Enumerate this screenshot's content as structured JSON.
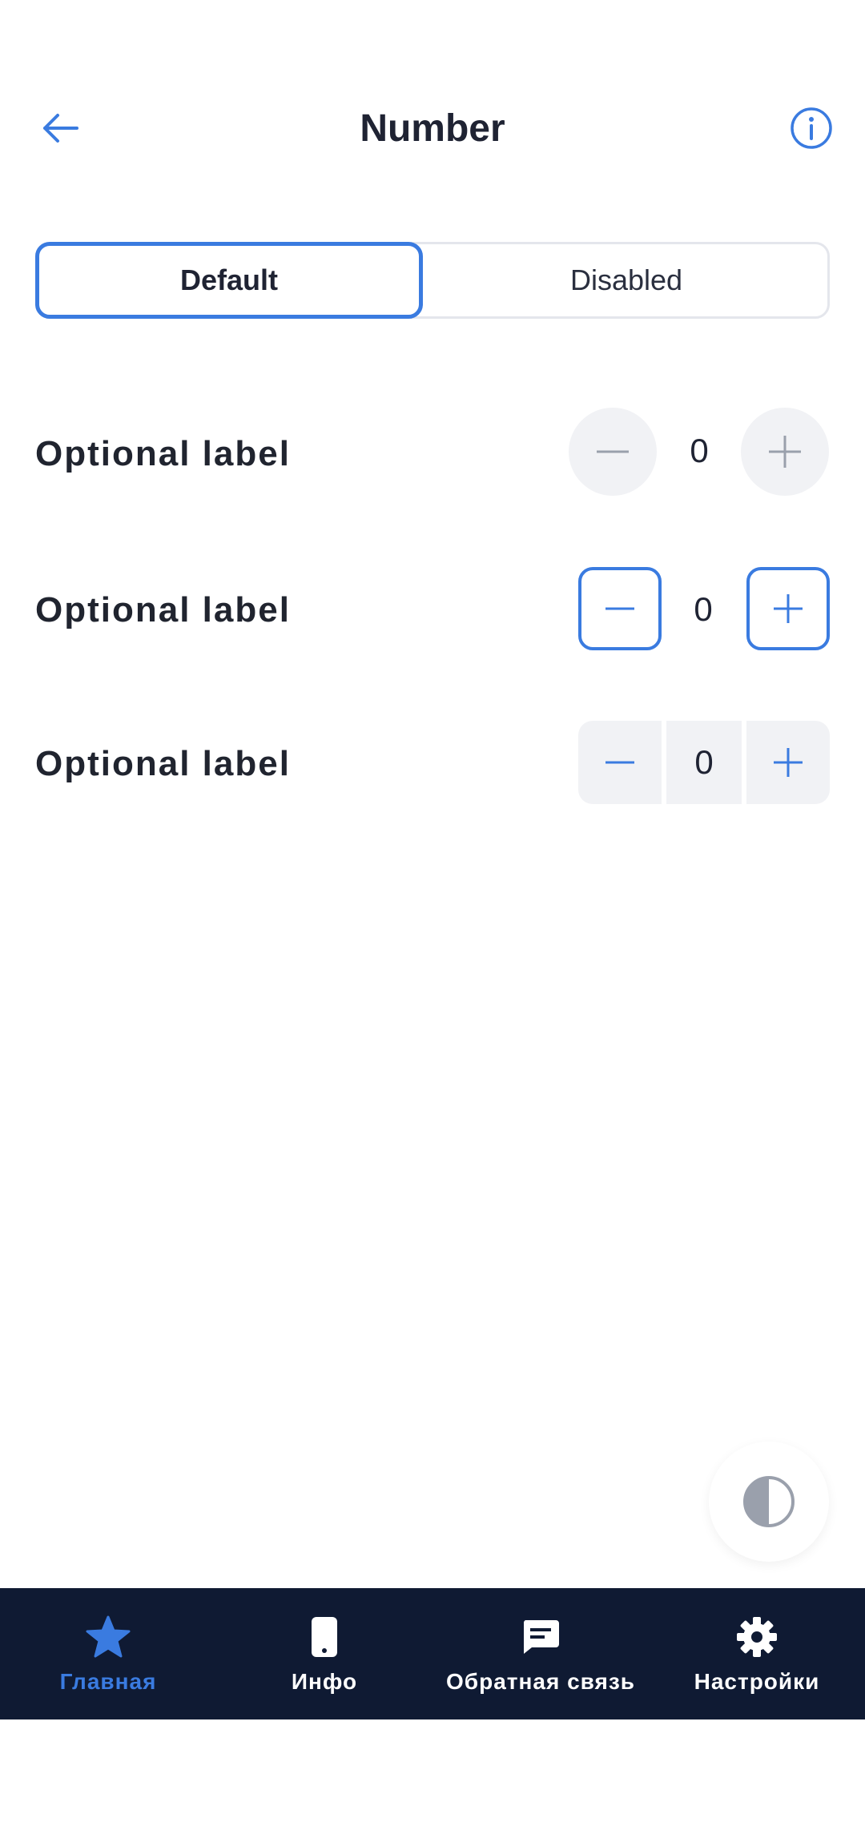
{
  "header": {
    "title": "Number"
  },
  "segmented": {
    "options": [
      "Default",
      "Disabled"
    ],
    "selected": "Default"
  },
  "rows": [
    {
      "label": "Optional label",
      "value": "0",
      "style": "circle"
    },
    {
      "label": "Optional label",
      "value": "0",
      "style": "outlined"
    },
    {
      "label": "Optional label",
      "value": "0",
      "style": "grouped"
    }
  ],
  "bottom_nav": {
    "items": [
      {
        "label": "Главная",
        "icon": "star-icon",
        "active": true
      },
      {
        "label": "Инфо",
        "icon": "phone-icon",
        "active": false
      },
      {
        "label": "Обратная связь",
        "icon": "chat-icon",
        "active": false
      },
      {
        "label": "Настройки",
        "icon": "gear-icon",
        "active": false
      }
    ]
  },
  "colors": {
    "accent": "#3a7be0",
    "nav_bg": "#0f1a33",
    "button_bg": "#f1f2f5",
    "text": "#1f2333"
  }
}
